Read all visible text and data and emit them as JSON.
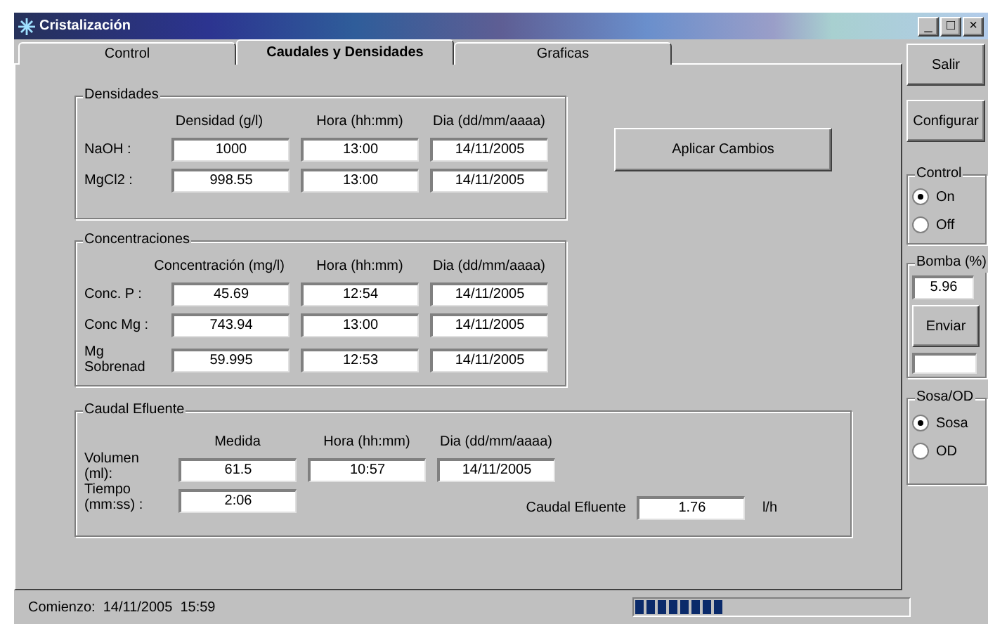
{
  "window": {
    "title": "Cristalización",
    "controls": [
      "_",
      "□",
      "×"
    ]
  },
  "tabs": [
    {
      "label": "Control",
      "selected": false
    },
    {
      "label": "Caudales y Densidades",
      "selected": true
    },
    {
      "label": "Graficas",
      "selected": false
    }
  ],
  "densidades": {
    "title": "Densidades",
    "columns": [
      "Densidad (g/l)",
      "Hora (hh:mm)",
      "Dia (dd/mm/aaaa)"
    ],
    "rows": [
      {
        "label": "NaOH :",
        "values": [
          "1000",
          "13:00",
          "14/11/2005"
        ]
      },
      {
        "label": "MgCl2 :",
        "values": [
          "998.55",
          "13:00",
          "14/11/2005"
        ]
      }
    ]
  },
  "apply_button": "Aplicar Cambios",
  "concentraciones": {
    "title": "Concentraciones",
    "columns": [
      "Concentración (mg/l)",
      "Hora (hh:mm)",
      "Dia (dd/mm/aaaa)"
    ],
    "rows": [
      {
        "label": "Conc. P :",
        "values": [
          "45.69",
          "12:54",
          "14/11/2005"
        ]
      },
      {
        "label": "Conc Mg :",
        "values": [
          "743.94",
          "13:00",
          "14/11/2005"
        ]
      },
      {
        "label": "Mg Sobrenad",
        "values": [
          "59.995",
          "12:53",
          "14/11/2005"
        ]
      }
    ]
  },
  "caudal": {
    "title": "Caudal Efluente",
    "columns": [
      "Medida",
      "Hora (hh:mm)",
      "Dia (dd/mm/aaaa)"
    ],
    "rows": [
      {
        "label": "Volumen (ml):",
        "values": [
          "61.5",
          "10:57",
          "14/11/2005"
        ]
      },
      {
        "label": "Tiempo (mm:ss) :",
        "values": [
          "2:06"
        ]
      }
    ],
    "result_label": "Caudal Efluente",
    "result": "1.76",
    "unit": "l/h"
  },
  "sidebar": {
    "exit_button": "Salir",
    "config_button": "Configurar",
    "control": {
      "title": "Control",
      "options": [
        {
          "label": "On",
          "selected": true
        },
        {
          "label": "Off",
          "selected": false
        }
      ]
    },
    "bomba": {
      "title": "Bomba (%)",
      "value": "5.96",
      "send_button": "Enviar"
    },
    "sosa": {
      "title": "Sosa/OD",
      "options": [
        {
          "label": "Sosa",
          "selected": true
        },
        {
          "label": "OD",
          "selected": false
        }
      ]
    }
  },
  "status_bar": {
    "text": "Comienzo:  14/11/2005  15:59",
    "progress": {
      "level": 0.33
    }
  }
}
